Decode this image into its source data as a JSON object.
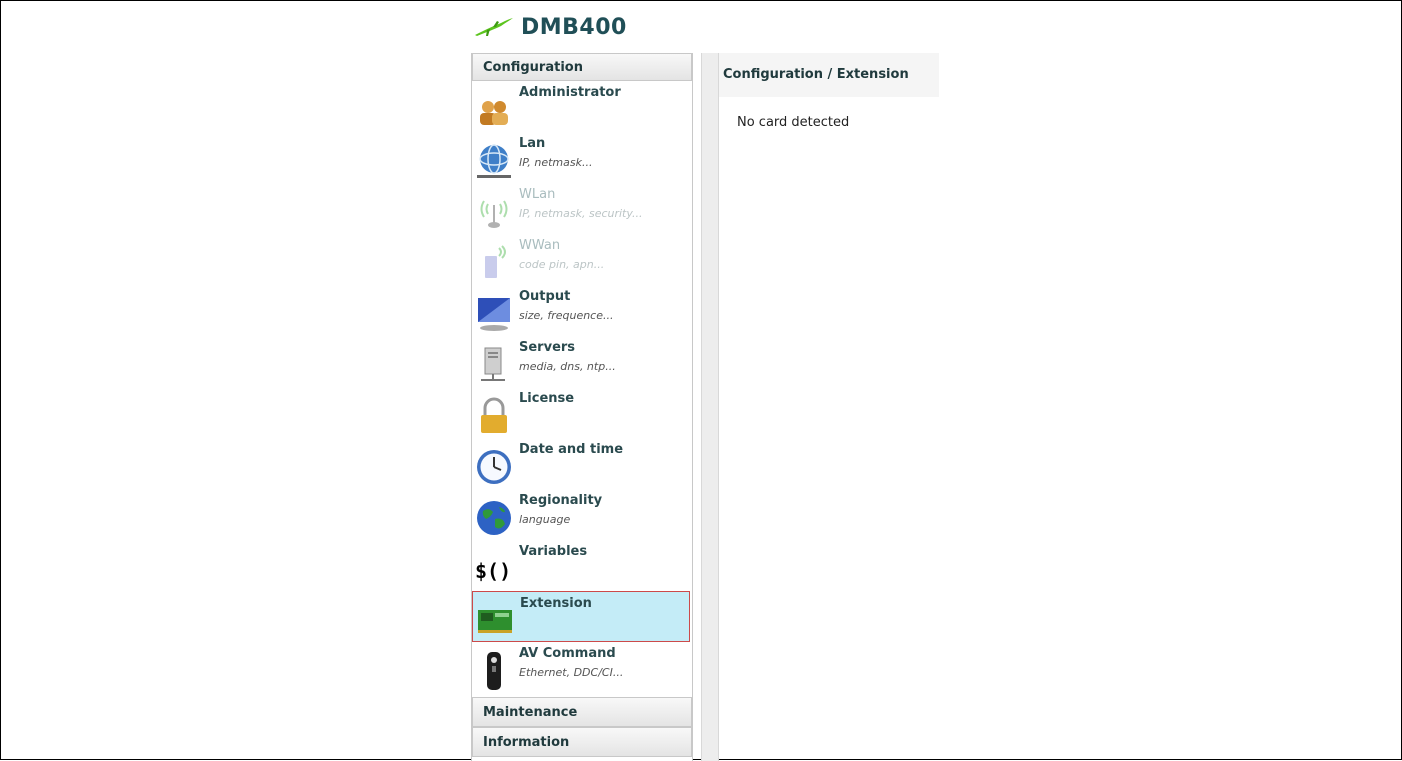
{
  "app": {
    "title": "DMB400"
  },
  "sidebar": {
    "section_configuration": "Configuration",
    "items": [
      {
        "label": "Administrator",
        "sub": "",
        "icon": "administrator-icon",
        "disabled": false,
        "selected": false
      },
      {
        "label": "Lan",
        "sub": "IP, netmask...",
        "icon": "network-globe-icon",
        "disabled": false,
        "selected": false
      },
      {
        "label": "WLan",
        "sub": "IP, netmask, security...",
        "icon": "wireless-antenna-icon",
        "disabled": true,
        "selected": false
      },
      {
        "label": "WWan",
        "sub": "code pin, apn...",
        "icon": "mobile-signal-icon",
        "disabled": true,
        "selected": false
      },
      {
        "label": "Output",
        "sub": "size, frequence...",
        "icon": "monitor-icon",
        "disabled": false,
        "selected": false
      },
      {
        "label": "Servers",
        "sub": "media, dns, ntp...",
        "icon": "server-icon",
        "disabled": false,
        "selected": false
      },
      {
        "label": "License",
        "sub": "",
        "icon": "padlock-icon",
        "disabled": false,
        "selected": false
      },
      {
        "label": "Date and time",
        "sub": "",
        "icon": "clock-icon",
        "disabled": false,
        "selected": false
      },
      {
        "label": "Regionality",
        "sub": "language",
        "icon": "earth-icon",
        "disabled": false,
        "selected": false
      },
      {
        "label": "Variables",
        "sub": "",
        "icon": "variables-icon",
        "disabled": false,
        "selected": false
      },
      {
        "label": "Extension",
        "sub": "",
        "icon": "extension-card-icon",
        "disabled": false,
        "selected": true
      },
      {
        "label": "AV Command",
        "sub": "Ethernet, DDC/CI...",
        "icon": "remote-control-icon",
        "disabled": false,
        "selected": false
      }
    ],
    "section_maintenance": "Maintenance",
    "section_information": "Information"
  },
  "content": {
    "breadcrumb": "Configuration / Extension",
    "message": "No card detected"
  },
  "colors": {
    "selected_bg": "#c4ecf7",
    "selected_border": "#cc4a4a",
    "title_color": "#204f57"
  }
}
